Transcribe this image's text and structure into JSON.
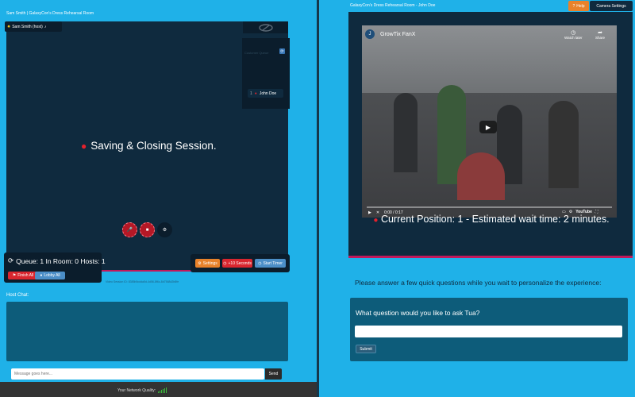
{
  "left": {
    "title": "Sam Smith | GalaxyCon's Dress Rehearsal Room",
    "host_badge": "Sam Smith (host)",
    "host_badge_icon": "mic-icon",
    "participant": {
      "number": "1",
      "name": "John Doe"
    },
    "stage_caption": "Customer Queue",
    "status_message": "Saving & Closing Session.",
    "queue_text": "Queue: 1 In Room: 0 Hosts: 1",
    "finish_all": "Finish All",
    "lobby_all": "Lobby All",
    "settings": "Settings",
    "plus_10": "+10 Seconds",
    "start_timer": "Start Timer",
    "session_id": "Video Session ID: 8385b5cdda5d-4d56-8f6c-8d7568d2b8fe",
    "host_chat_label": "Host Chat:",
    "message_placeholder": "Message goes here...",
    "send": "Send",
    "network_quality": "Your Network Quality:"
  },
  "right": {
    "title": "GalaxyCon's Dress Rehearsal Room - John Doe",
    "help": "Help",
    "camera_settings": "Camera Settings",
    "video": {
      "channel_initial": "J",
      "channel_title": "GrowTix FanX",
      "watch_later": "Watch later",
      "share": "Share",
      "time": "0:00 / 0:17",
      "brand": "YouTube",
      "progress": 0
    },
    "position_message": "Current Position: 1 - Estimated wait time: 2 minutes.",
    "questions_intro": "Please answer a few quick questions while you wait to personalize the experience:",
    "question": "What question would you like to ask Tua?",
    "answer_value": "",
    "submit": "Submit"
  },
  "colors": {
    "page_bg": "#1fb1e8",
    "panel_dark": "#0f2a3e",
    "orange": "#e8822a",
    "red": "#d9262f",
    "blue_btn": "#4b8ec7",
    "accent_pink": "#c2185b"
  }
}
